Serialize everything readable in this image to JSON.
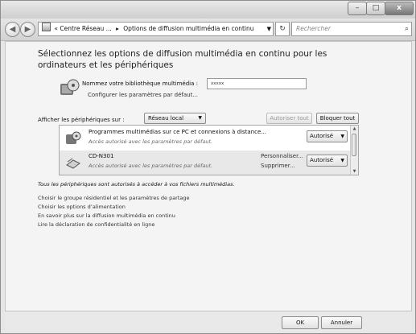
{
  "window": {
    "controls": {
      "minimize": "–",
      "maximize": "□",
      "close": "x"
    }
  },
  "nav": {
    "back_icon": "back-arrow-icon",
    "forward_icon": "forward-arrow-icon",
    "address": {
      "prefix": "«",
      "crumb1": "Centre Réseau ...",
      "separator": "▸",
      "crumb2": "Options de diffusion multimédia en continu"
    },
    "refresh_glyph": "↻",
    "search_placeholder": "Rechercher"
  },
  "main": {
    "heading": "Sélectionnez les options de diffusion multimédia en continu pour les ordinateurs et les périphériques",
    "library": {
      "label": "Nommez votre bibliothèque multimédia :",
      "value": "xxxxx",
      "default_link": "Configurer les paramètres par défaut..."
    },
    "show_devices": {
      "label": "Afficher les périphériques sur :",
      "selected": "Réseau local"
    },
    "buttons": {
      "allow_all": "Autoriser tout",
      "block_all": "Bloquer tout"
    },
    "devices": [
      {
        "name": "Programmes multimédias sur ce PC et connexions à distance...",
        "sub": "Accès autorisé avec les paramètres par défaut.",
        "status": "Autorisé"
      },
      {
        "name": "CD-N301",
        "sub": "Accès autorisé avec les paramètres par défaut.",
        "link1": "Personnaliser...",
        "link2": "Supprimer...",
        "status": "Autorisé"
      }
    ],
    "all_note": "Tous les périphériques sont autorisés à accéder à vos fichiers multimédias.",
    "links": [
      "Choisir le groupe résidentiel et les paramètres de partage",
      "Choisir les options d’alimentation",
      "En savoir plus sur la diffusion multimédia en continu",
      "Lire la déclaration de confidentialité en ligne"
    ]
  },
  "footer": {
    "ok": "OK",
    "cancel": "Annuler"
  }
}
